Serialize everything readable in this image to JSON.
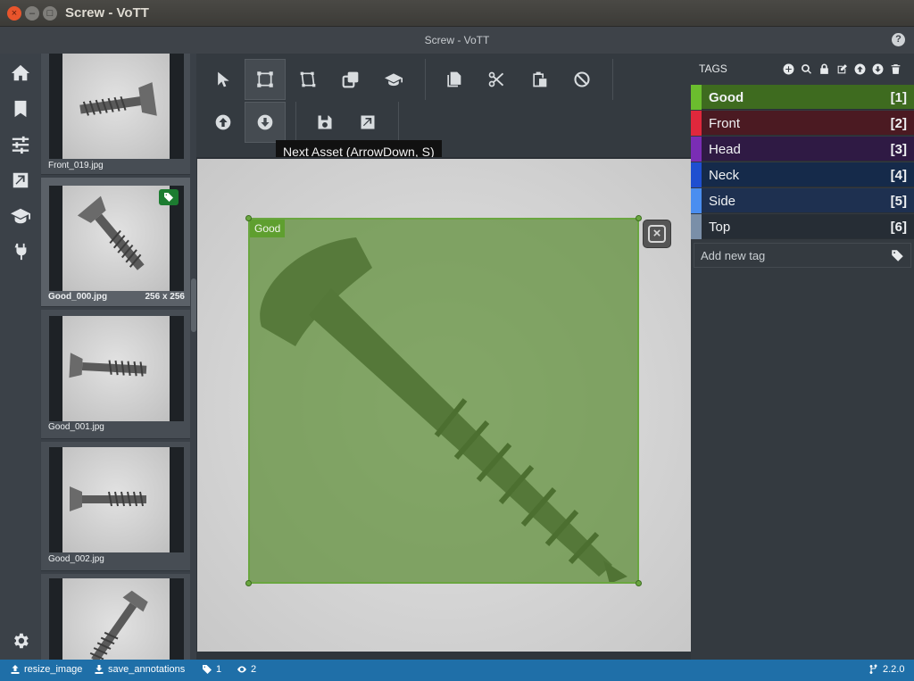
{
  "window": {
    "title": "Screw - VoTT"
  },
  "header": {
    "title": "Screw - VoTT",
    "help_icon": "?"
  },
  "thumbnails": [
    {
      "caption": "Front_019.jpg",
      "size": ""
    },
    {
      "caption": "Good_000.jpg",
      "size": "256 x 256"
    },
    {
      "caption": "Good_001.jpg",
      "size": ""
    },
    {
      "caption": "Good_002.jpg",
      "size": ""
    },
    {
      "caption": "",
      "size": ""
    }
  ],
  "toolbar": {
    "tooltip": "Next Asset (ArrowDown, S)"
  },
  "region": {
    "label": "Good",
    "color": "#6aa640"
  },
  "tags": {
    "title": "TAGS",
    "items": [
      {
        "name": "Good",
        "key": "[1]",
        "color": "#6bbd2e",
        "bg": "#3e6b1f"
      },
      {
        "name": "Front",
        "key": "[2]",
        "color": "#e0283c",
        "bg": "#4b1a22"
      },
      {
        "name": "Head",
        "key": "[3]",
        "color": "#7a2db5",
        "bg": "#2f1a44"
      },
      {
        "name": "Neck",
        "key": "[4]",
        "color": "#1f4fd0",
        "bg": "#152a4a"
      },
      {
        "name": "Side",
        "key": "[5]",
        "color": "#4a8ef0",
        "bg": "#1e3050"
      },
      {
        "name": "Top",
        "key": "[6]",
        "color": "#7a8fa8",
        "bg": "#262d35"
      }
    ],
    "add_placeholder": "Add new tag"
  },
  "status": {
    "export": "resize_image",
    "save": "save_annotations",
    "tags_count": "1",
    "visited_count": "2",
    "version": "2.2.0"
  }
}
